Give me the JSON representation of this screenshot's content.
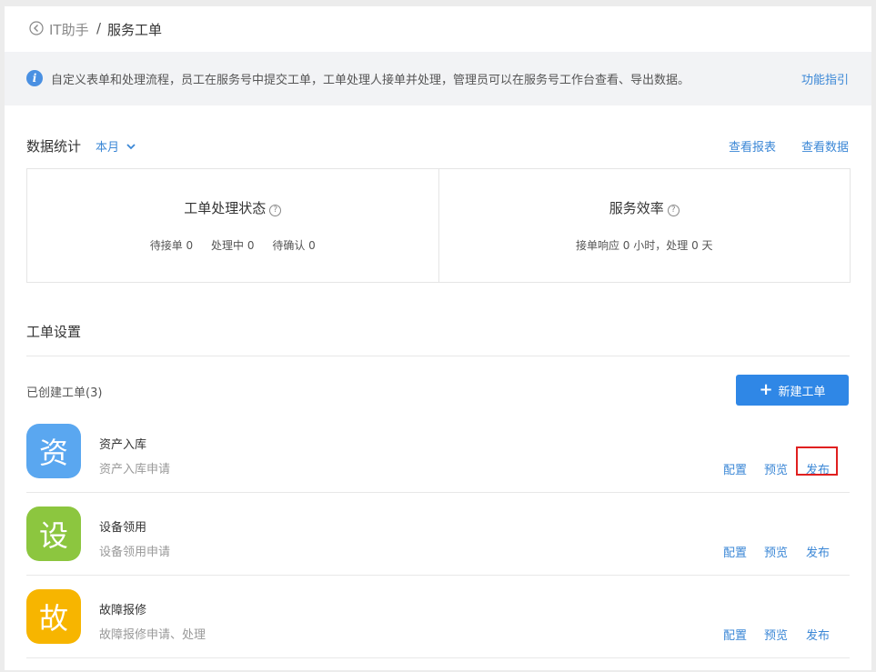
{
  "breadcrumb": {
    "back_label": "IT助手",
    "separator": "/",
    "current": "服务工单"
  },
  "info": {
    "text": "自定义表单和处理流程，员工在服务号中提交工单，工单处理人接单并处理，管理员可以在服务号工作台查看、导出数据。",
    "guide_link": "功能指引"
  },
  "stats": {
    "title": "数据统计",
    "period": "本月",
    "view_report": "查看报表",
    "view_data": "查看数据",
    "status_card": {
      "title": "工单处理状态",
      "items": [
        {
          "label": "待接单",
          "value": "0"
        },
        {
          "label": "处理中",
          "value": "0"
        },
        {
          "label": "待确认",
          "value": "0"
        }
      ]
    },
    "efficiency_card": {
      "title": "服务效率",
      "line": "接单响应 0 小时，处理 0 天"
    }
  },
  "settings": {
    "title": "工单设置",
    "created_label": "已创建工单(3)",
    "new_button": "新建工单",
    "rows": [
      {
        "icon_char": "资",
        "icon_color": "#5aa7f0",
        "title": "资产入库",
        "desc": "资产入库申请",
        "config": "配置",
        "preview": "预览",
        "publish": "发布"
      },
      {
        "icon_char": "设",
        "icon_color": "#8cc63f",
        "title": "设备领用",
        "desc": "设备领用申请",
        "config": "配置",
        "preview": "预览",
        "publish": "发布"
      },
      {
        "icon_char": "故",
        "icon_color": "#f7b500",
        "title": "故障报修",
        "desc": "故障报修申请、处理",
        "config": "配置",
        "preview": "预览",
        "publish": "发布"
      }
    ]
  },
  "colors": {
    "accent": "#3b87d6",
    "button": "#2f87e6",
    "highlight": "#e02020"
  }
}
